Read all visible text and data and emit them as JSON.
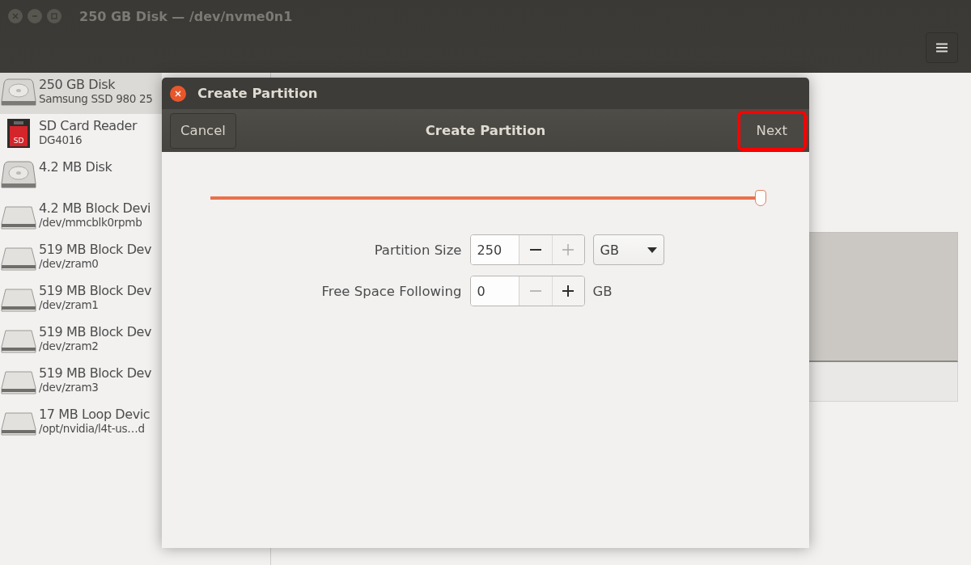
{
  "window": {
    "title": "250 GB Disk — /dev/nvme0n1"
  },
  "sidebar": {
    "items": [
      {
        "kind": "hdd",
        "name": "250 GB Disk",
        "detail": "Samsung SSD 980 25",
        "selected": true
      },
      {
        "kind": "sd",
        "icon_text": "SD",
        "name": "SD Card Reader",
        "detail": "DG4016",
        "selected": false
      },
      {
        "kind": "hdd",
        "name": "4.2 MB Disk",
        "selected": false
      },
      {
        "kind": "drive",
        "name": "4.2 MB Block Devi",
        "detail": "/dev/mmcblk0rpmb",
        "selected": false
      },
      {
        "kind": "drive",
        "name": "519 MB Block Dev",
        "detail": "/dev/zram0",
        "selected": false
      },
      {
        "kind": "drive",
        "name": "519 MB Block Dev",
        "detail": "/dev/zram1",
        "selected": false
      },
      {
        "kind": "drive",
        "name": "519 MB Block Dev",
        "detail": "/dev/zram2",
        "selected": false
      },
      {
        "kind": "drive",
        "name": "519 MB Block Dev",
        "detail": "/dev/zram3",
        "selected": false
      },
      {
        "kind": "drive",
        "name": "17 MB Loop Devic",
        "detail": "/opt/nvidia/l4t-us…d",
        "selected": false
      }
    ]
  },
  "dialog": {
    "title": "Create Partition",
    "header_title": "Create Partition",
    "cancel": {
      "label": "Cancel"
    },
    "next": {
      "label": "Next",
      "highlighted": true
    },
    "size_slider": {
      "level": 1
    },
    "fields": [
      {
        "kind": "dropdown",
        "label": "Partition Size",
        "value": "250",
        "minus_disabled": false,
        "plus_disabled": true,
        "unit": "GB"
      },
      {
        "kind": "text",
        "label": "Free Space Following",
        "value": "0",
        "minus_disabled": true,
        "plus_disabled": false,
        "unit": "GB"
      }
    ]
  }
}
